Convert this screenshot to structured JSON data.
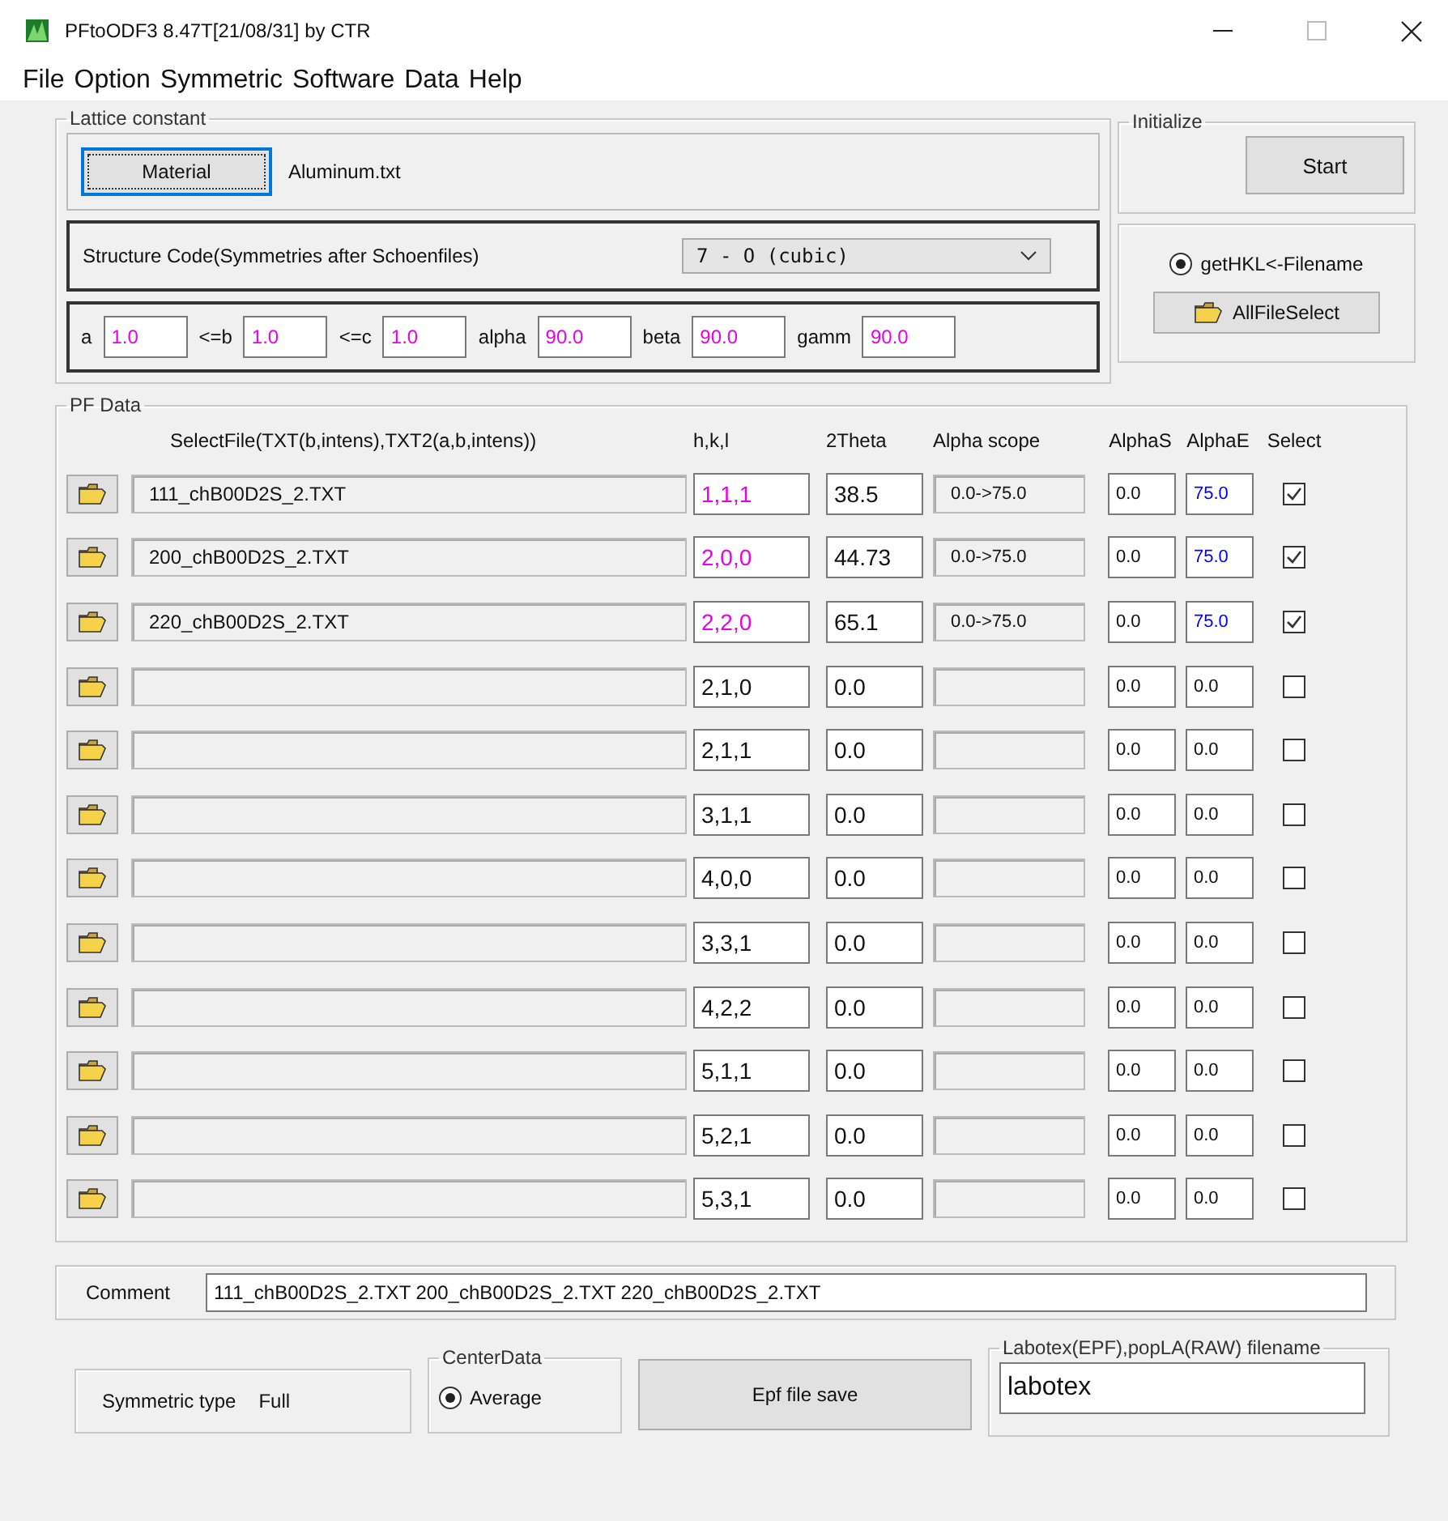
{
  "window": {
    "title": "PFtoODF3 8.47T[21/08/31] by CTR"
  },
  "menu": [
    "File",
    "Option",
    "Symmetric",
    "Software",
    "Data",
    "Help"
  ],
  "lattice": {
    "title": "Lattice constant",
    "material_button": "Material",
    "material_file": "Aluminum.txt",
    "structure_label": "Structure Code(Symmetries after Schoenfiles)",
    "structure_value": "7 - O (cubic)",
    "params": [
      {
        "label": "a",
        "value": "1.0"
      },
      {
        "label": "<=b",
        "value": "1.0"
      },
      {
        "label": "<=c",
        "value": "1.0"
      },
      {
        "label": "alpha",
        "value": "90.0"
      },
      {
        "label": "beta",
        "value": "90.0"
      },
      {
        "label": "gamm",
        "value": "90.0"
      }
    ]
  },
  "initialize": {
    "title": "Initialize",
    "start_button": "Start"
  },
  "hkl_source": {
    "radio_label": "getHKL<-Filename",
    "selected": true,
    "all_file_select": "AllFileSelect"
  },
  "pf_data": {
    "title": "PF Data",
    "columns": [
      "SelectFile(TXT(b,intens),TXT2(a,b,intens))",
      "h,k,l",
      "2Theta",
      "Alpha scope",
      "AlphaS",
      "AlphaE",
      "Select"
    ],
    "rows": [
      {
        "file": "111_chB00D2S_2.TXT",
        "hkl": "1,1,1",
        "two_theta": "38.5",
        "alpha_scope": "0.0->75.0",
        "alpha_s": "0.0",
        "alpha_e": "75.0",
        "selected": true
      },
      {
        "file": "200_chB00D2S_2.TXT",
        "hkl": "2,0,0",
        "two_theta": "44.73",
        "alpha_scope": "0.0->75.0",
        "alpha_s": "0.0",
        "alpha_e": "75.0",
        "selected": true
      },
      {
        "file": "220_chB00D2S_2.TXT",
        "hkl": "2,2,0",
        "two_theta": "65.1",
        "alpha_scope": "0.0->75.0",
        "alpha_s": "0.0",
        "alpha_e": "75.0",
        "selected": true
      },
      {
        "hkl": "2,1,0",
        "two_theta": "0.0",
        "alpha_s": "0.0",
        "alpha_e": "0.0",
        "selected": false
      },
      {
        "hkl": "2,1,1",
        "two_theta": "0.0",
        "alpha_s": "0.0",
        "alpha_e": "0.0",
        "selected": false
      },
      {
        "hkl": "3,1,1",
        "two_theta": "0.0",
        "alpha_s": "0.0",
        "alpha_e": "0.0",
        "selected": false
      },
      {
        "hkl": "4,0,0",
        "two_theta": "0.0",
        "alpha_s": "0.0",
        "alpha_e": "0.0",
        "selected": false
      },
      {
        "hkl": "3,3,1",
        "two_theta": "0.0",
        "alpha_s": "0.0",
        "alpha_e": "0.0",
        "selected": false
      },
      {
        "hkl": "4,2,2",
        "two_theta": "0.0",
        "alpha_s": "0.0",
        "alpha_e": "0.0",
        "selected": false
      },
      {
        "hkl": "5,1,1",
        "two_theta": "0.0",
        "alpha_s": "0.0",
        "alpha_e": "0.0",
        "selected": false
      },
      {
        "hkl": "5,2,1",
        "two_theta": "0.0",
        "alpha_s": "0.0",
        "alpha_e": "0.0",
        "selected": false
      },
      {
        "hkl": "5,3,1",
        "two_theta": "0.0",
        "alpha_s": "0.0",
        "alpha_e": "0.0",
        "selected": false
      }
    ]
  },
  "comment": {
    "label": "Comment",
    "value": "111_chB00D2S_2.TXT 200_chB00D2S_2.TXT 220_chB00D2S_2.TXT"
  },
  "symmetric_type": {
    "label": "Symmetric type",
    "value": "Full"
  },
  "center_data": {
    "title": "CenterData",
    "option": {
      "label": "Average",
      "selected": true
    }
  },
  "epf_save_button": "Epf file save",
  "labotex": {
    "title": "Labotex(EPF),popLA(RAW) filename",
    "value": "labotex"
  }
}
